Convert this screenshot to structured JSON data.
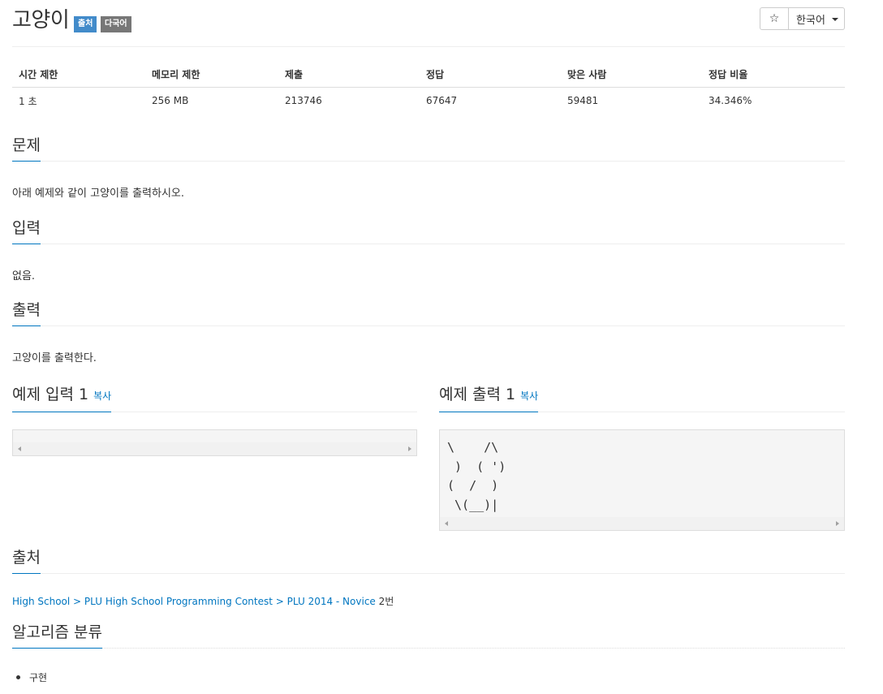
{
  "problem": {
    "title": "고양이",
    "badges": [
      "출처",
      "다국어"
    ],
    "star_glyph": "☆",
    "language": "한국어"
  },
  "info_table": {
    "headers": [
      "시간 제한",
      "메모리 제한",
      "제출",
      "정답",
      "맞은 사람",
      "정답 비율"
    ],
    "values": [
      "1 초",
      "256 MB",
      "213746",
      "67647",
      "59481",
      "34.346%"
    ]
  },
  "sections": {
    "description": {
      "title": "문제",
      "text": "아래 예제와 같이 고양이를 출력하시오."
    },
    "input": {
      "title": "입력",
      "text": "없음."
    },
    "output": {
      "title": "출력",
      "text": "고양이를 출력한다."
    },
    "sample_input": {
      "title": "예제 입력 1",
      "copy_label": "복사",
      "lines": []
    },
    "sample_output": {
      "title": "예제 출력 1",
      "copy_label": "복사",
      "lines": [
        "\\    /\\",
        " )  ( ')",
        "(  /  )",
        " \\(__)|"
      ]
    },
    "source": {
      "title": "출처",
      "links": [
        "High School",
        "PLU High School Programming Contest",
        "PLU 2014 - Novice"
      ],
      "separator": " > ",
      "suffix": " 2번"
    },
    "tags": {
      "title": "알고리즘 분류",
      "items": [
        "구현"
      ]
    }
  },
  "colors": {
    "accent": "#0076c0",
    "badge_blue": "#428bca",
    "badge_gray": "#777777"
  }
}
